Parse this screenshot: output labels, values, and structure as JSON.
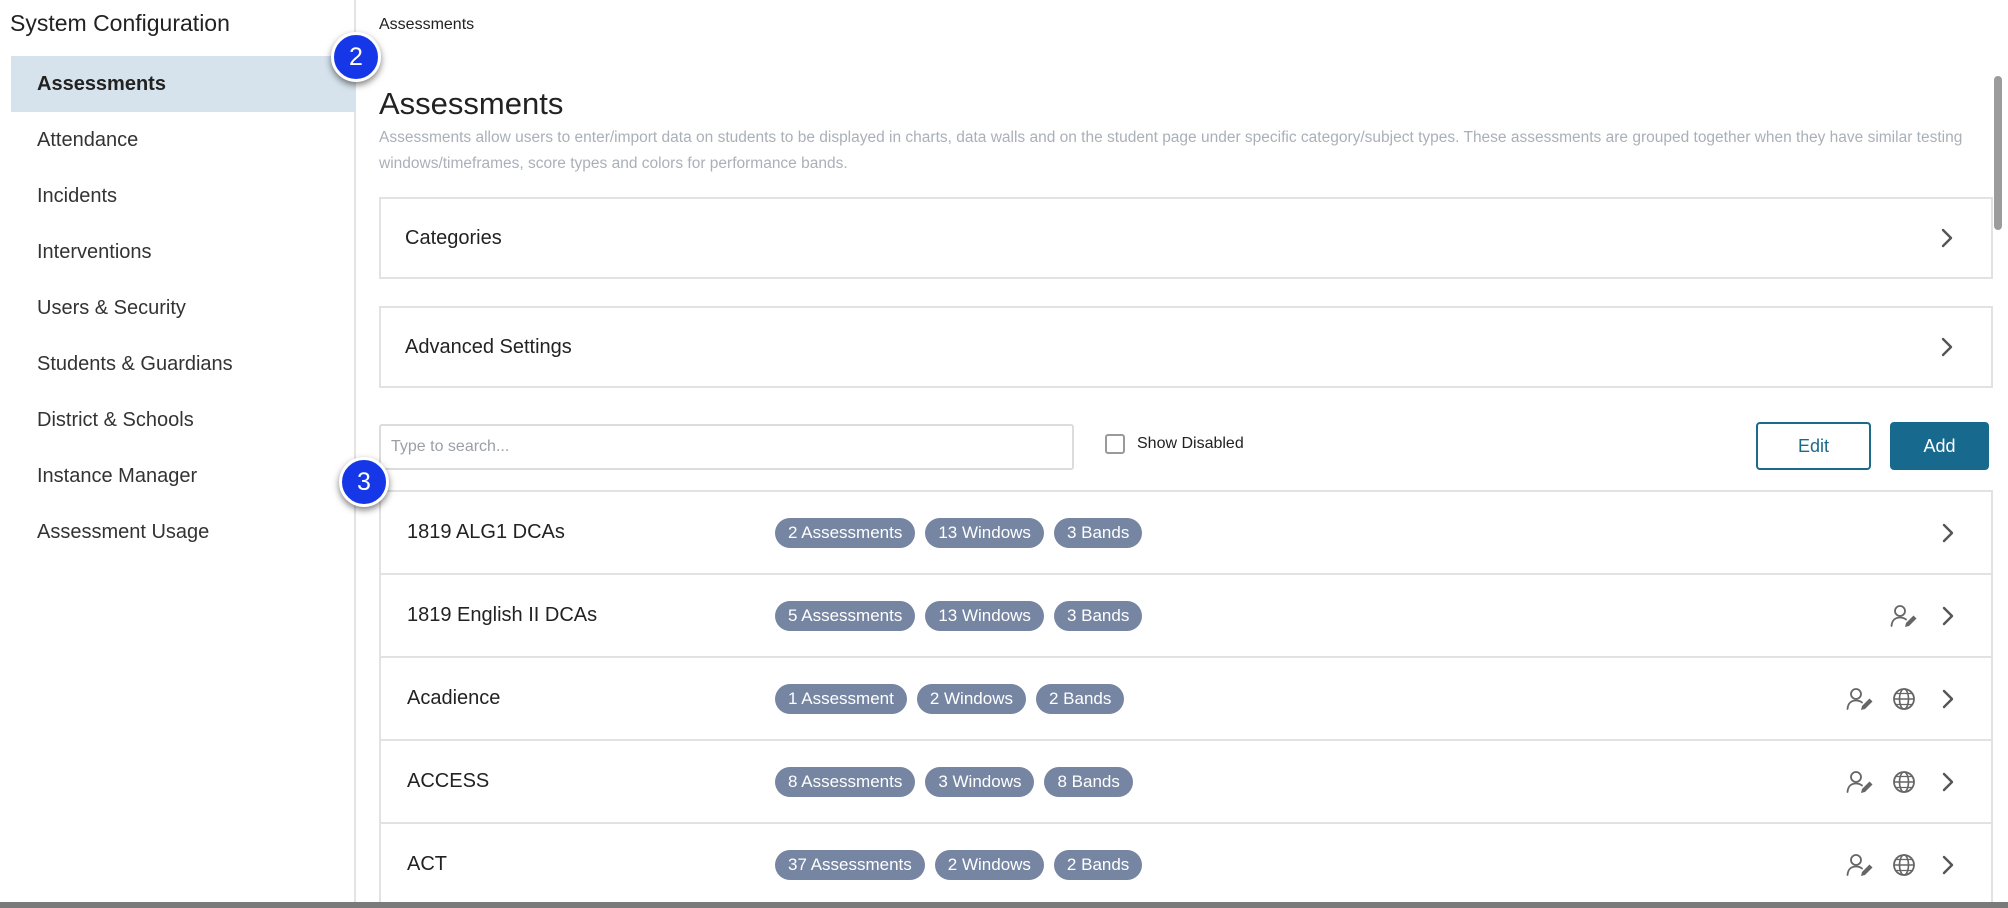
{
  "sidebar": {
    "title": "System Configuration",
    "items": [
      {
        "label": "Assessments",
        "active": true
      },
      {
        "label": "Attendance"
      },
      {
        "label": "Incidents"
      },
      {
        "label": "Interventions"
      },
      {
        "label": "Users & Security"
      },
      {
        "label": "Students & Guardians"
      },
      {
        "label": "District & Schools"
      },
      {
        "label": "Instance Manager"
      },
      {
        "label": "Assessment Usage"
      }
    ]
  },
  "callouts": [
    "2",
    "3"
  ],
  "main": {
    "breadcrumb": "Assessments",
    "title": "Assessments",
    "description": "Assessments allow users to enter/import data on students to be displayed in charts, data walls and on the student page under specific category/subject types. These assessments are grouped together when they have similar testing windows/timeframes, score types and colors for performance bands.",
    "panels": [
      "Categories",
      "Advanced Settings"
    ],
    "search": {
      "placeholder": "Type to search..."
    },
    "show_disabled_label": "Show Disabled",
    "edit_label": "Edit",
    "add_label": "Add",
    "rows": [
      {
        "name": "1819 ALG1 DCAs",
        "pills": [
          "2 Assessments",
          "13 Windows",
          "3 Bands"
        ],
        "icons": [
          "chevron-right"
        ]
      },
      {
        "name": "1819 English II DCAs",
        "pills": [
          "5 Assessments",
          "13 Windows",
          "3 Bands"
        ],
        "icons": [
          "user-edit",
          "chevron-right"
        ]
      },
      {
        "name": "Acadience",
        "pills": [
          "1 Assessment",
          "2 Windows",
          "2 Bands"
        ],
        "icons": [
          "user-edit",
          "globe",
          "chevron-right"
        ]
      },
      {
        "name": "ACCESS",
        "pills": [
          "8 Assessments",
          "3 Windows",
          "8 Bands"
        ],
        "icons": [
          "user-edit",
          "globe",
          "chevron-right"
        ]
      },
      {
        "name": "ACT",
        "pills": [
          "37 Assessments",
          "2 Windows",
          "2 Bands"
        ],
        "icons": [
          "user-edit",
          "globe",
          "chevron-right"
        ]
      }
    ]
  },
  "colors": {
    "accent": "#176a8e",
    "sidebar_active_bg": "#d6e3ec",
    "pill_bg": "#7585a2",
    "callout_badge": "#1537e8"
  }
}
